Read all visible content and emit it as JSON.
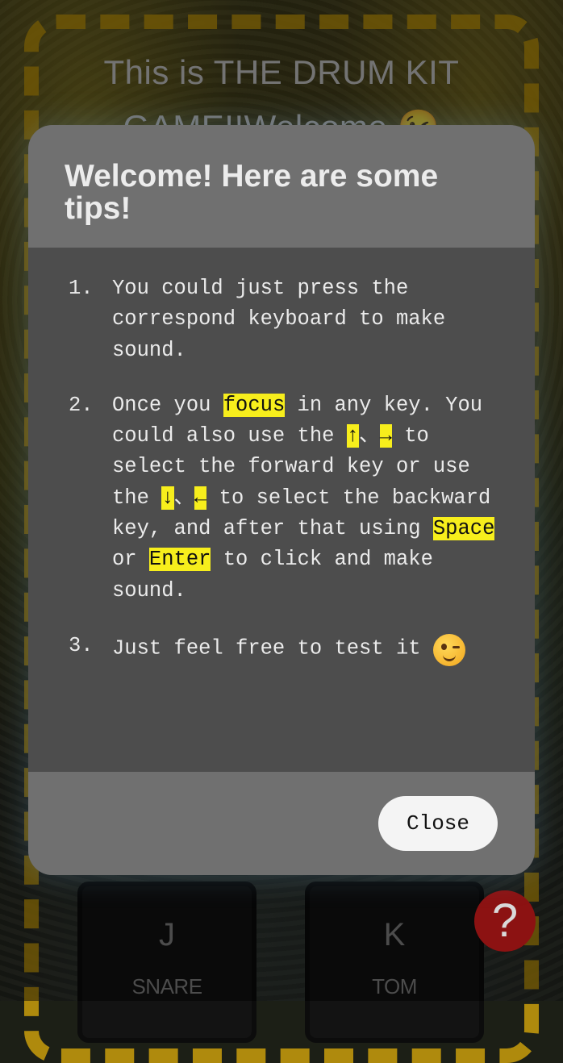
{
  "game": {
    "title": "This is THE DRUM KIT GAME!!Welcome 😉"
  },
  "keys": [
    {
      "letter": "J",
      "sound": "SNARE"
    },
    {
      "letter": "K",
      "sound": "TOM"
    }
  ],
  "help_button": {
    "label": "?"
  },
  "modal": {
    "title": "Welcome! Here are some tips!",
    "tips": [
      {
        "number": "1.",
        "text": "You could just press the correspond keyboard to make sound."
      },
      {
        "number": "2.",
        "t1": "Once you ",
        "focus": "focus",
        "t2": " in any key. You could also use the ",
        "up": "↑",
        "sep1": "、",
        "right": "→",
        "t3": " to select the forward key or use the ",
        "down": "↓",
        "sep2": "、",
        "left": "←",
        "t4": " to select the backward key, and after that using ",
        "space": "Space",
        "t5": " or ",
        "enter": "Enter",
        "t6": " to click and make sound."
      },
      {
        "number": "3.",
        "text": "Just feel free to test it",
        "emoji": "wink-emoji"
      }
    ],
    "close_label": "Close"
  },
  "colors": {
    "frame": "#c99d0c",
    "highlight": "#f7ee1c",
    "help_button": "#8c1212"
  }
}
